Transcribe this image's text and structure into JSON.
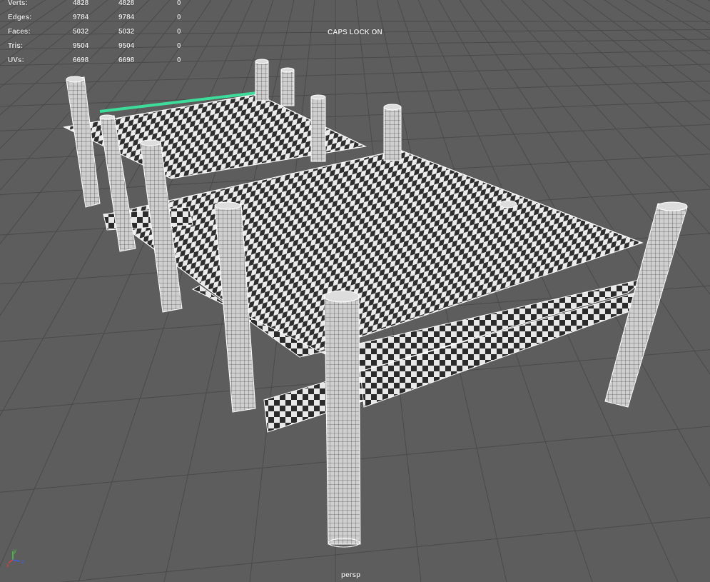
{
  "hud": {
    "rows": [
      {
        "label": "Verts:",
        "v1": "4828",
        "v2": "4828",
        "v3": "0"
      },
      {
        "label": "Edges:",
        "v1": "9784",
        "v2": "9784",
        "v3": "0"
      },
      {
        "label": "Faces:",
        "v1": "5032",
        "v2": "5032",
        "v3": "0"
      },
      {
        "label": "Tris:",
        "v1": "9504",
        "v2": "9504",
        "v3": "0"
      },
      {
        "label": "UVs:",
        "v1": "6698",
        "v2": "6698",
        "v3": "0"
      }
    ]
  },
  "status": {
    "caps_lock": "CAPS LOCK ON"
  },
  "camera": {
    "name": "persp"
  },
  "axis": {
    "x": "x",
    "y": "y",
    "z": "z"
  },
  "colors": {
    "background": "#5d5d5d",
    "grid": "#4a4a4a",
    "wire": "#ffffff",
    "selected_edge": "#3ddc9a",
    "axis_x": "#e04040",
    "axis_y": "#40d040",
    "axis_z": "#4060e0"
  }
}
